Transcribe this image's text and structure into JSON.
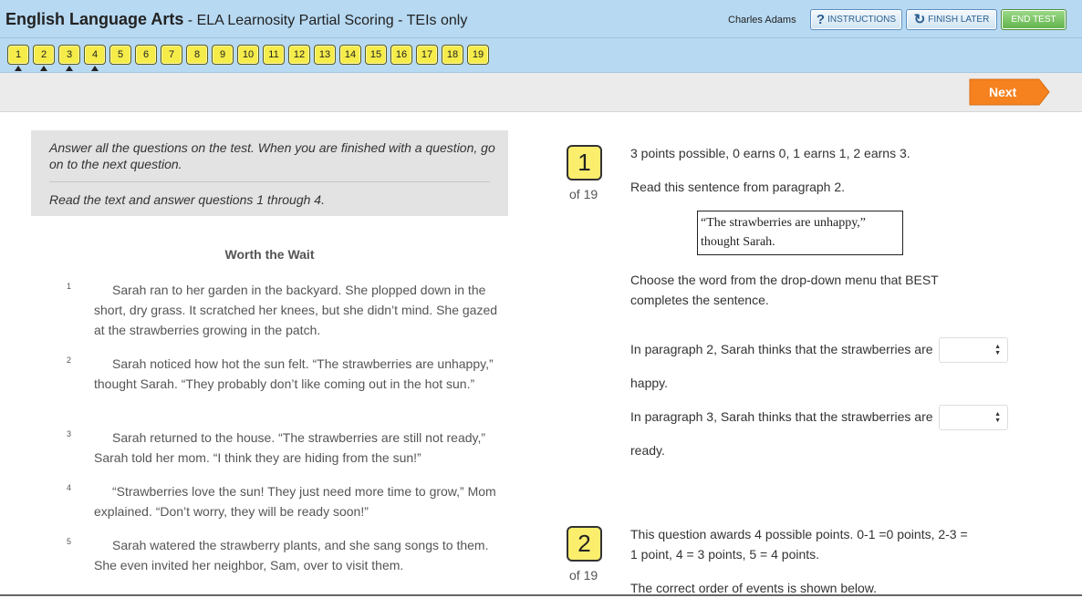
{
  "header": {
    "title_bold": "English Language Arts",
    "title_rest": " - ELA Learnosity Partial Scoring - TEIs only",
    "user_name": "Charles Adams",
    "instructions_label": "Instructions",
    "finish_later_label": "Finish Later",
    "end_test_label": "End Test"
  },
  "nav": {
    "questions": [
      "1",
      "2",
      "3",
      "4",
      "5",
      "6",
      "7",
      "8",
      "9",
      "10",
      "11",
      "12",
      "13",
      "14",
      "15",
      "16",
      "17",
      "18",
      "19"
    ],
    "flagged": [
      "1",
      "2",
      "3",
      "4"
    ]
  },
  "toolbar": {
    "next_label": "Next"
  },
  "passage": {
    "instruction_1": "Answer all the questions on the test. When you are finished with a question, go on to the next question.",
    "instruction_2": "Read the text and answer questions 1 through 4.",
    "title": "Worth the Wait",
    "paragraphs": [
      {
        "num": "1",
        "text": "Sarah ran to her garden in the backyard. She plopped down in the short, dry grass. It scratched her knees, but she didn’t mind. She gazed at the strawberries growing in the patch."
      },
      {
        "num": "2",
        "text": "Sarah noticed how hot the sun felt. “The strawberries are unhappy,” thought Sarah. “They probably don’t like coming out in the hot sun.”"
      },
      {
        "num": "3",
        "text": "Sarah returned to the house. “The strawberries are still not ready,” Sarah told her mom. “I think they are hiding from the sun!”"
      },
      {
        "num": "4",
        "text": "“Strawberries love the sun! They just need more time to grow,” Mom explained. “Don’t worry, they will be ready soon!”"
      },
      {
        "num": "5",
        "text": "Sarah watered the strawberry plants, and she sang songs to them. She even invited her neighbor, Sam, over to visit them."
      }
    ]
  },
  "q1": {
    "number": "1",
    "of": "of 19",
    "scoring": "3 points possible, 0 earns 0, 1 earns 1, 2 earns 3.",
    "prompt": "Read this sentence from paragraph 2.",
    "quote": "“The strawberries are unhappy,” thought Sarah.",
    "instruction": "Choose the word from the drop-down menu that BEST completes the sentence.",
    "line1": "In paragraph 2, Sarah thinks that the strawberries are",
    "line1_end": "happy.",
    "line2": "In paragraph 3, Sarah thinks that the strawberries are",
    "line2_end": "ready.",
    "select1_value": "",
    "select2_value": ""
  },
  "q2": {
    "number": "2",
    "of": "of 19",
    "scoring": "This question awards 4 possible points. 0-1 =0 points, 2-3 = 1 point, 4 = 3 points, 5 = 4 points.",
    "prompt": "The correct order of events is shown below."
  },
  "colors": {
    "header_bg": "#b7d9f2",
    "question_button": "#f5ec4a",
    "next_button": "#f5821f",
    "end_test": "#5fb24a"
  }
}
